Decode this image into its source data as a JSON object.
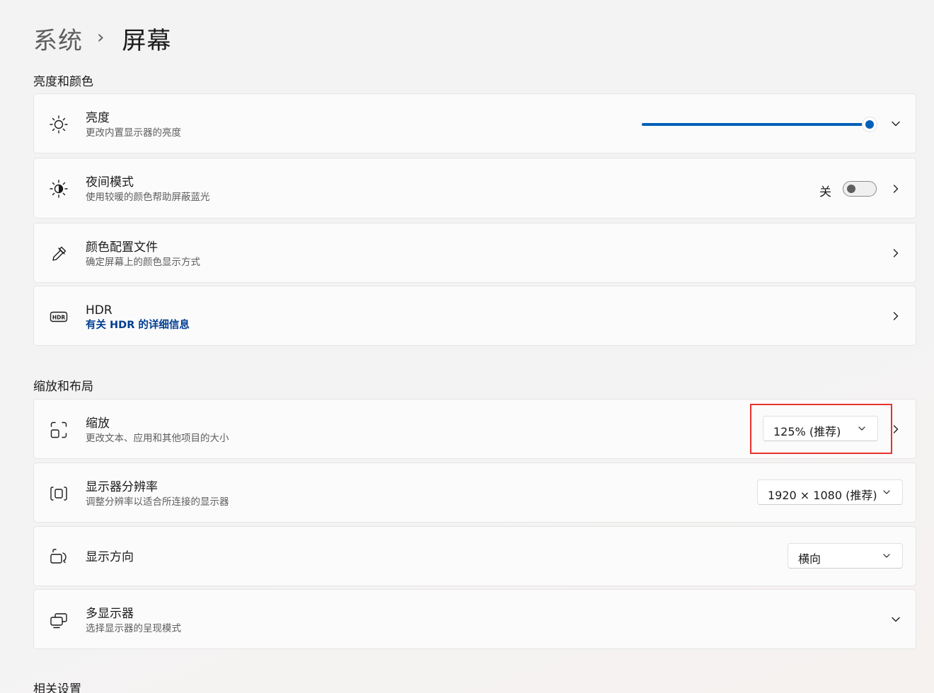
{
  "breadcrumb": {
    "parent": "系统",
    "separator": "›",
    "current": "屏幕"
  },
  "sections": {
    "brightness_color": "亮度和颜色",
    "scale_layout": "缩放和布局",
    "related": "相关设置"
  },
  "brightness": {
    "title": "亮度",
    "subtitle": "更改内置显示器的亮度",
    "value_percent": 100,
    "icon": "sun-icon"
  },
  "night_light": {
    "title": "夜间模式",
    "subtitle": "使用较暖的颜色帮助屏蔽蓝光",
    "state_label": "关",
    "enabled": false,
    "icon": "night-light-icon"
  },
  "color_profile": {
    "title": "颜色配置文件",
    "subtitle": "确定屏幕上的颜色显示方式",
    "icon": "eyedropper-icon"
  },
  "hdr": {
    "title": "HDR",
    "link": "有关 HDR 的详细信息",
    "icon": "hdr-icon"
  },
  "scale": {
    "title": "缩放",
    "subtitle": "更改文本、应用和其他项目的大小",
    "value": "125% (推荐)",
    "icon": "scale-icon"
  },
  "resolution": {
    "title": "显示器分辨率",
    "subtitle": "调整分辨率以适合所连接的显示器",
    "value": "1920 × 1080 (推荐)",
    "icon": "resolution-icon"
  },
  "orientation": {
    "title": "显示方向",
    "value": "横向",
    "icon": "orientation-icon"
  },
  "multi_display": {
    "title": "多显示器",
    "subtitle": "选择显示器的呈现模式",
    "icon": "multi-display-icon"
  },
  "colors": {
    "accent": "#005fb8",
    "link": "#003e92",
    "highlight": "#e8322d"
  }
}
